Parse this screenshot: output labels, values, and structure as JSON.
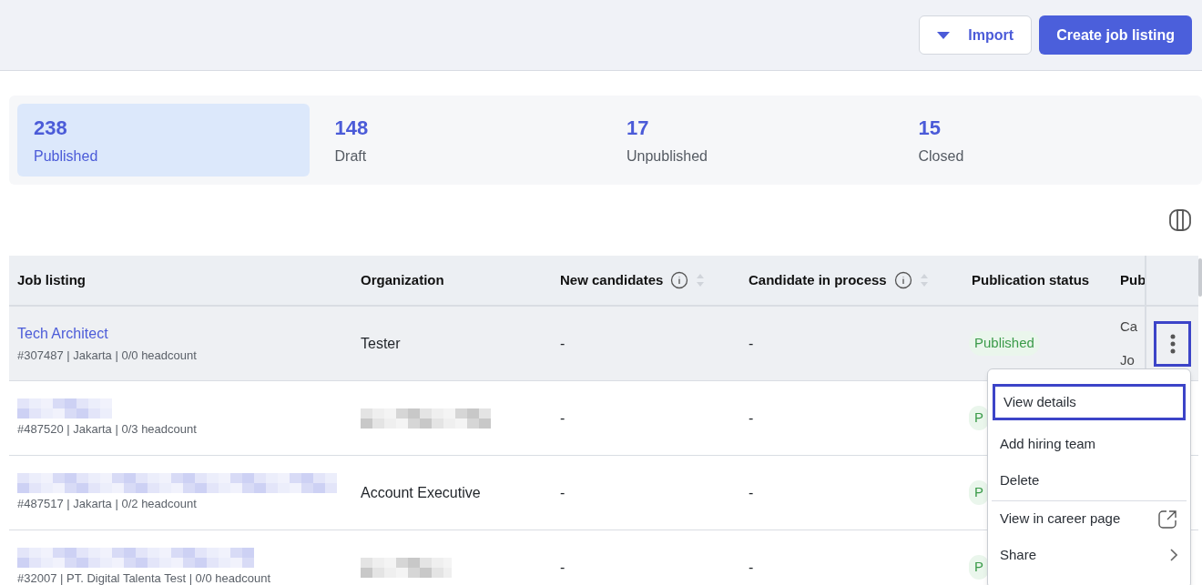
{
  "toolbar": {
    "import_button": "Import",
    "create_button": "Create job listing"
  },
  "stats": [
    {
      "count": "238",
      "label": "Published",
      "selected": true
    },
    {
      "count": "148",
      "label": "Draft",
      "selected": false
    },
    {
      "count": "17",
      "label": "Unpublished",
      "selected": false
    },
    {
      "count": "15",
      "label": "Closed",
      "selected": false
    }
  ],
  "table": {
    "columns": [
      {
        "label": "Job listing",
        "kind": "plain"
      },
      {
        "label": "Organization",
        "kind": "plain"
      },
      {
        "label": "New candidates",
        "kind": "sortable"
      },
      {
        "label": "Candidate in process",
        "kind": "sortable"
      },
      {
        "label": "Publication status",
        "kind": "plain"
      },
      {
        "label": "Pub",
        "kind": "plain"
      }
    ],
    "rows": [
      {
        "title": "Tech Architect",
        "title_redacted": false,
        "meta": "#307487 | Jakarta | 0/0 headcount",
        "organization": "Tester",
        "organization_redacted": false,
        "new_candidates": "-",
        "in_process": "-",
        "status": "Published",
        "column_6": [
          "Ca",
          "Jo"
        ],
        "selected": true
      },
      {
        "title_redacted": true,
        "meta": "#487520 | Jakarta | 0/3 headcount",
        "organization_redacted": true,
        "new_candidates": "-",
        "in_process": "-",
        "status": "P",
        "selected": false
      },
      {
        "title_redacted": true,
        "meta": "#487517 | Jakarta | 0/2 headcount",
        "organization": "Account Executive",
        "organization_redacted": false,
        "new_candidates": "-",
        "in_process": "-",
        "status": "P",
        "selected": false
      },
      {
        "title_redacted": true,
        "meta": "#32007 | PT. Digital Talenta Test | 0/0 headcount",
        "organization_redacted": true,
        "new_candidates": "-",
        "in_process": "-",
        "status": "P",
        "selected": false
      }
    ]
  },
  "row_menu": {
    "items": [
      {
        "label": "View details",
        "kind": "plain",
        "selected": true
      },
      {
        "label": "Add hiring team",
        "kind": "plain",
        "selected": false
      },
      {
        "label": "Delete",
        "kind": "plain",
        "selected": false
      },
      {
        "label": "View in career page",
        "kind": "external",
        "selected": false
      },
      {
        "label": "Share",
        "kind": "submenu",
        "selected": false
      }
    ]
  }
}
